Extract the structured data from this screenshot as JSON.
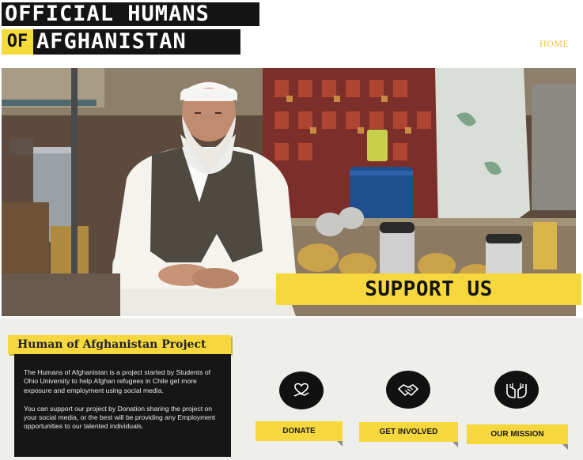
{
  "header": {
    "logo_line1": "OFFICIAL HUMANS",
    "logo_of": "OF",
    "logo_line2": "AFGHANISTAN",
    "nav_home": "HOME"
  },
  "hero": {
    "banner_label": "SUPPORT US"
  },
  "project": {
    "title": "Human of Afghanistan Project",
    "paragraph1": "The Humans of Afghanistan is a project started by Students of Ohio University to help Afghan refugees in Chile get more exposure and employment using social media.",
    "paragraph2": "You can support our project by Donation sharing the project on your social media, or the best will be providing any Employment opportunities to our talented individuals."
  },
  "actions": {
    "donate_label": "DONATE",
    "donate_icon": "heart-hand-icon",
    "get_involved_label": "GET INVOLVED",
    "get_involved_icon": "handshake-icon",
    "our_mission_label": "OUR MISSION",
    "our_mission_icon": "open-hands-icon"
  },
  "colors": {
    "accent_yellow": "#f6d83e",
    "dark": "#141414",
    "section_bg": "#eeeeea"
  }
}
